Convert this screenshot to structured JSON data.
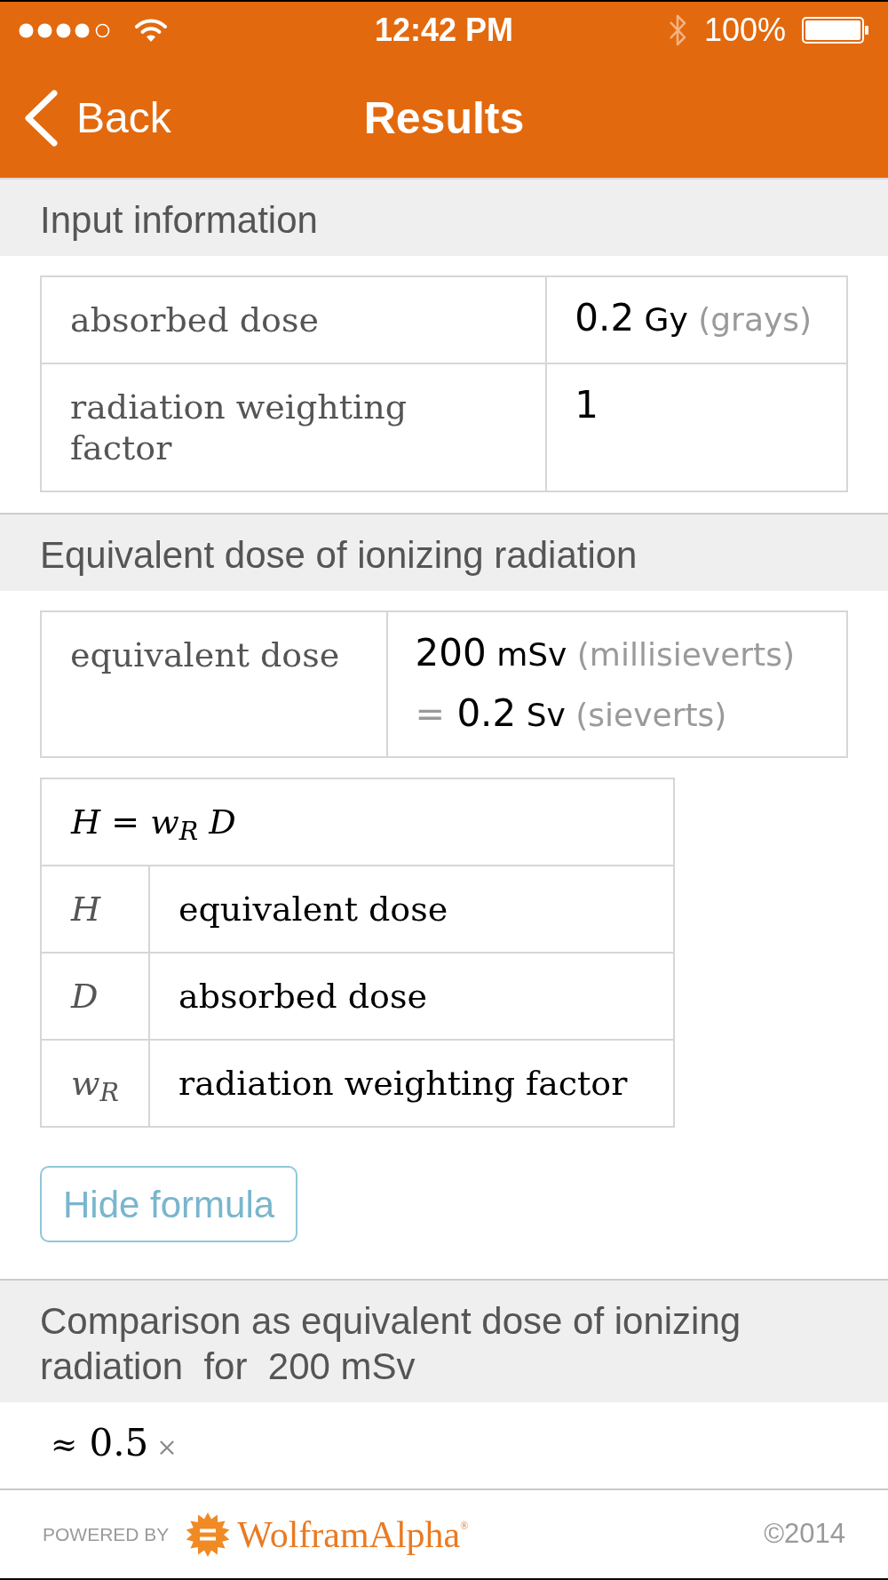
{
  "status_bar": {
    "time": "12:42 PM",
    "battery": "100%"
  },
  "nav_bar": {
    "back": "Back",
    "title": "Results"
  },
  "sections": [
    {
      "title": "Input information",
      "table": {
        "rows": [
          {
            "label": "absorbed dose",
            "value_lines": [
              [
                {
                  "kind": "number",
                  "text": "0.2"
                },
                {
                  "kind": "unit",
                  "text": "Gy"
                },
                {
                  "kind": "note",
                  "text": "(grays)"
                }
              ]
            ]
          },
          {
            "label": "radiation weighting factor",
            "value_lines": [
              [
                {
                  "kind": "number",
                  "text": "1"
                }
              ]
            ]
          }
        ]
      }
    },
    {
      "title": "Equivalent dose of ionizing radiation",
      "table": {
        "rows": [
          {
            "label": "equivalent dose",
            "value_lines": [
              [
                {
                  "kind": "number",
                  "text": "200"
                },
                {
                  "kind": "unit",
                  "text": "mSv"
                },
                {
                  "kind": "note",
                  "text": "(millisieverts)"
                }
              ],
              [
                {
                  "kind": "equals",
                  "text": "="
                },
                {
                  "kind": "number",
                  "text": "0.2"
                },
                {
                  "kind": "unit",
                  "text": "Sv"
                },
                {
                  "kind": "note",
                  "text": "(sieverts)"
                }
              ]
            ]
          }
        ]
      },
      "formula": {
        "equation": "H = w$_{R}$ D",
        "symbols": [
          {
            "symbol": "H",
            "meaning": "equivalent dose"
          },
          {
            "symbol": "D",
            "meaning": "absorbed dose"
          },
          {
            "symbol": "w$_{R}$",
            "meaning": "radiation weighting factor"
          }
        ]
      },
      "button": {
        "label": "Hide formula"
      }
    },
    {
      "title": "Comparison as equivalent dose of ionizing radiation  for  200 mSv",
      "result": [
        {
          "kind": "approx",
          "text": "≈"
        },
        {
          "kind": "number",
          "text": "0.5"
        },
        {
          "kind": "times",
          "text": "×"
        }
      ]
    }
  ],
  "footer": {
    "powered_by": "POWERED BY",
    "brand": "WolframAlpha$^{®}$",
    "copyright": "©2014"
  }
}
